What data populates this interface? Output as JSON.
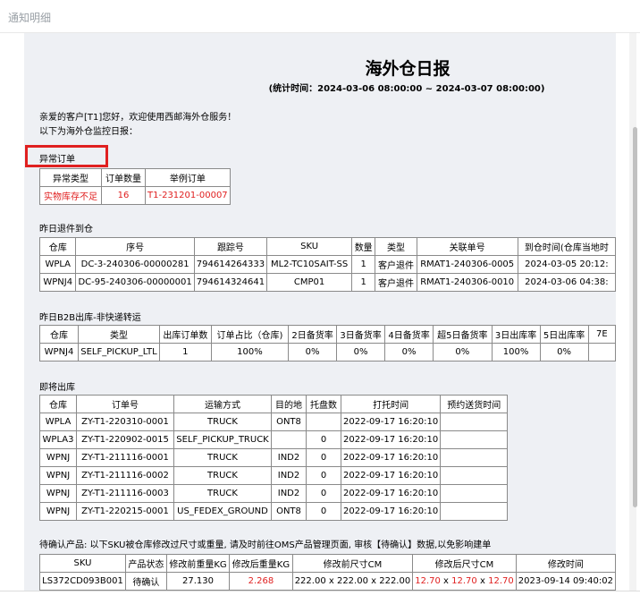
{
  "window": {
    "title": "通知明细"
  },
  "report": {
    "title": "海外仓日报",
    "subtitle": "(统计时间：2024-03-06 08:00:00 ~ 2024-03-07 08:00:00)",
    "greeting": "亲爱的客户[T1]您好，欢迎使用西邮海外仓服务！",
    "intro": "以下为海外仓监控日报："
  },
  "abnormal": {
    "title": "异常订单",
    "headers": [
      "异常类型",
      "订单数量",
      "举例订单"
    ],
    "rows": [
      [
        "实物库存不足",
        "16",
        "T1-231201-00007"
      ]
    ]
  },
  "returns": {
    "title": "昨日退件到仓",
    "headers": [
      "仓库",
      "序号",
      "跟踪号",
      "SKU",
      "数量",
      "类型",
      "关联单号",
      "到仓时间(仓库当地时"
    ],
    "rows": [
      [
        "WPLA",
        "DC-3-240306-00000281",
        "794614264333",
        "ML2-TC10SAIT-SS",
        "1",
        "客户退件",
        "RMAT1-240306-0005",
        "2024-03-05 20:12:"
      ],
      [
        "WPNJ4",
        "DC-95-240306-00000001",
        "794614324641",
        "CMP01",
        "1",
        "客户退件",
        "RMAT1-240306-0010",
        "2024-03-06 04:38:"
      ]
    ]
  },
  "b2b": {
    "title": "昨日B2B出库-非快递转运",
    "headers": [
      "仓库",
      "类型",
      "出库订单数",
      "订单占比（仓库)",
      "2日备货率",
      "3日备货率",
      "4日备货率",
      "超5日备货率",
      "3日出库率",
      "5日出库率",
      "7E"
    ],
    "rows": [
      [
        "WPNJ4",
        "SELF_PICKUP_LTL",
        "1",
        "100%",
        "0%",
        "0%",
        "0%",
        "0%",
        "100%",
        "0%",
        ""
      ]
    ]
  },
  "upcoming": {
    "title": "即将出库",
    "headers": [
      "仓库",
      "订单号",
      "运输方式",
      "目的地",
      "托盘数",
      "打托时间",
      "预约送货时间"
    ],
    "rows": [
      [
        "WPLA",
        "ZY-T1-220310-0001",
        "TRUCK",
        "ONT8",
        "",
        "2022-09-17 16:20:10",
        ""
      ],
      [
        "WPLA3",
        "ZY-T1-220902-0015",
        "SELF_PICKUP_TRUCK",
        "",
        "0",
        "2022-09-17 16:20:10",
        ""
      ],
      [
        "WPNJ",
        "ZY-T1-211116-0001",
        "TRUCK",
        "IND2",
        "0",
        "2022-09-17 16:20:10",
        ""
      ],
      [
        "WPNJ",
        "ZY-T1-211116-0002",
        "TRUCK",
        "IND2",
        "0",
        "2022-09-17 16:20:10",
        ""
      ],
      [
        "WPNJ",
        "ZY-T1-211116-0003",
        "TRUCK",
        "IND2",
        "0",
        "2022-09-17 16:20:10",
        ""
      ],
      [
        "WPNJ",
        "ZY-T1-220215-0001",
        "US_FEDEX_GROUND",
        "ONT8",
        "0",
        "2022-09-17 16:20:10",
        ""
      ]
    ]
  },
  "pending": {
    "title": "待确认产品: 以下SKU被仓库修改过尺寸或重量, 请及时前往OMS产品管理页面, 审核【待确认】数据,以免影响建单",
    "headers": [
      "SKU",
      "产品状态",
      "修改前重量KG",
      "修改后重量KG",
      "修改前尺寸CM",
      "修改后尺寸CM",
      "修改时间"
    ],
    "row": {
      "sku": "LS372CD093B001",
      "status": "待确认",
      "weight_before": "27.130",
      "weight_after": "2.268",
      "size_before": "222.00 x 222.00 x 222.00",
      "size_after_l": "12.70",
      "size_after_w": "12.70",
      "size_after_h": "12.70",
      "size_sep": "x",
      "modified_at": "2023-09-14 09:40:02"
    }
  },
  "colors": {
    "highlight": "#e02020",
    "doc_bg": "#eef0f4",
    "border": "#8a8a8a"
  }
}
